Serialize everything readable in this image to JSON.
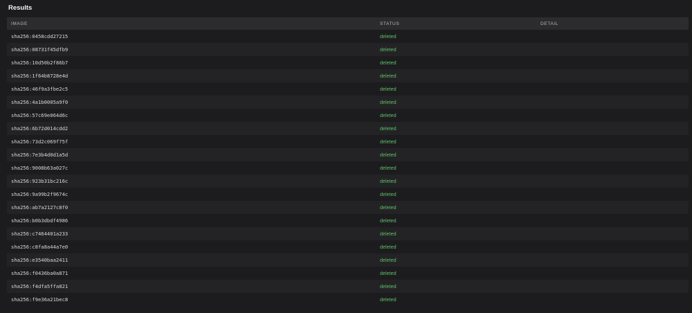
{
  "title": "Results",
  "columns": {
    "image": "IMAGE",
    "status": "STATUS",
    "detail": "DETAIL"
  },
  "colors": {
    "background": "#1c1c1e",
    "header_background": "#2c2c2e",
    "status_deleted": "#5fbf6a"
  },
  "rows": [
    {
      "image": "sha256:0458cdd27215",
      "status": "deleted",
      "detail": ""
    },
    {
      "image": "sha256:08731f45dfb9",
      "status": "deleted",
      "detail": ""
    },
    {
      "image": "sha256:10d50b2f86b7",
      "status": "deleted",
      "detail": ""
    },
    {
      "image": "sha256:1f64b8728e4d",
      "status": "deleted",
      "detail": ""
    },
    {
      "image": "sha256:46f9a3fbe2c5",
      "status": "deleted",
      "detail": ""
    },
    {
      "image": "sha256:4a1b0005a9f0",
      "status": "deleted",
      "detail": ""
    },
    {
      "image": "sha256:57c69e064d6c",
      "status": "deleted",
      "detail": ""
    },
    {
      "image": "sha256:6b72d014cdd2",
      "status": "deleted",
      "detail": ""
    },
    {
      "image": "sha256:73d2c069f75f",
      "status": "deleted",
      "detail": ""
    },
    {
      "image": "sha256:7e3b4d0d1a5d",
      "status": "deleted",
      "detail": ""
    },
    {
      "image": "sha256:9008b63a027c",
      "status": "deleted",
      "detail": ""
    },
    {
      "image": "sha256:923b31bc216c",
      "status": "deleted",
      "detail": ""
    },
    {
      "image": "sha256:9a99b2f9674c",
      "status": "deleted",
      "detail": ""
    },
    {
      "image": "sha256:ab7a2127c8f0",
      "status": "deleted",
      "detail": ""
    },
    {
      "image": "sha256:b0b3dbdf4986",
      "status": "deleted",
      "detail": ""
    },
    {
      "image": "sha256:c7464401a233",
      "status": "deleted",
      "detail": ""
    },
    {
      "image": "sha256:c8fa8a44a7e0",
      "status": "deleted",
      "detail": ""
    },
    {
      "image": "sha256:e3540baa2411",
      "status": "deleted",
      "detail": ""
    },
    {
      "image": "sha256:f0436ba0a871",
      "status": "deleted",
      "detail": ""
    },
    {
      "image": "sha256:f4dfa5ffa821",
      "status": "deleted",
      "detail": ""
    },
    {
      "image": "sha256:f9e36a21bec8",
      "status": "deleted",
      "detail": ""
    }
  ]
}
